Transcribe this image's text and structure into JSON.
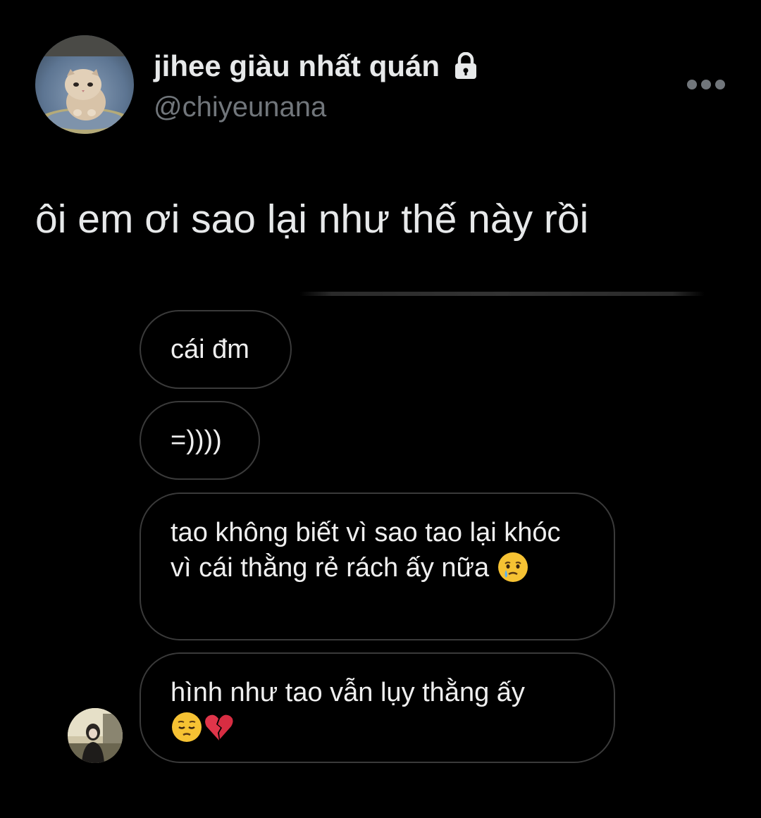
{
  "tweet": {
    "display_name": "jihee giàu nhất quán",
    "handle": "@chiyeunana",
    "text": "ôi em ơi sao lại như thế này rồi",
    "icons": {
      "lock": "lock-icon",
      "more": "more-options-icon"
    }
  },
  "chat": {
    "messages": [
      {
        "text": "cái đm"
      },
      {
        "text": "=))))"
      },
      {
        "text": "tao không biết vì sao tao lại khóc vì cái thằng rẻ rách ấy nữa",
        "emoji": "crying-face-emoji"
      },
      {
        "text": "hình như tao vẫn lụy thằng ấy",
        "emoji": [
          "pensive-face-emoji",
          "broken-heart-emoji"
        ]
      }
    ]
  },
  "colors": {
    "background": "#000000",
    "primary_text": "#e7e9ea",
    "secondary_text": "#71767b",
    "bubble_border": "#3a3a3a"
  }
}
